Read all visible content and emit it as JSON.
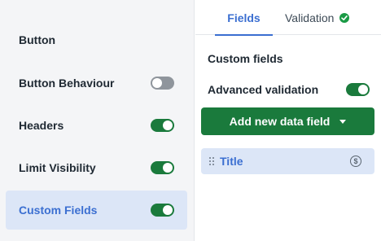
{
  "sidebar": {
    "items": [
      {
        "label": "Button",
        "toggle": null,
        "active": false
      },
      {
        "label": "Button Behaviour",
        "toggle": false,
        "active": false
      },
      {
        "label": "Headers",
        "toggle": true,
        "active": false
      },
      {
        "label": "Limit Visibility",
        "toggle": true,
        "active": false
      },
      {
        "label": "Custom Fields",
        "toggle": true,
        "active": true
      }
    ]
  },
  "tabs": {
    "fields": "Fields",
    "validation": "Validation",
    "validation_status_icon": "check-circle-icon"
  },
  "panel": {
    "section_title": "Custom fields",
    "advanced_validation_label": "Advanced validation",
    "advanced_validation_enabled": true,
    "add_button_label": "Add new data field",
    "fields": [
      {
        "label": "Title",
        "icon": "dollar-circle-icon"
      }
    ]
  },
  "colors": {
    "accent_green": "#1a7a3c",
    "accent_blue": "#3b6fd1",
    "active_bg": "#dce6f7"
  }
}
